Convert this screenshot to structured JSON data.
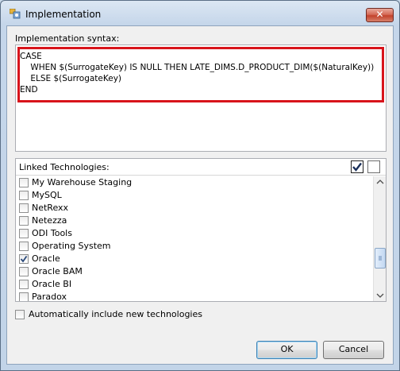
{
  "window": {
    "title": "Implementation",
    "close_label": "✕"
  },
  "syntax": {
    "label": "Implementation syntax:",
    "lines": [
      "CASE",
      "    WHEN $(SurrogateKey) IS NULL THEN LATE_DIMS.D_PRODUCT_DIM($(NaturalKey))",
      "    ELSE $(SurrogateKey)",
      "END"
    ],
    "highlight_color": "#d8141b"
  },
  "technologies": {
    "label": "Linked Technologies:",
    "items": [
      {
        "label": "My Warehouse Staging",
        "checked": false
      },
      {
        "label": "MySQL",
        "checked": false
      },
      {
        "label": "NetRexx",
        "checked": false
      },
      {
        "label": "Netezza",
        "checked": false
      },
      {
        "label": "ODI Tools",
        "checked": false
      },
      {
        "label": "Operating System",
        "checked": false
      },
      {
        "label": "Oracle",
        "checked": true
      },
      {
        "label": "Oracle BAM",
        "checked": false
      },
      {
        "label": "Oracle BI",
        "checked": false
      },
      {
        "label": "Paradox",
        "checked": false
      }
    ]
  },
  "auto_include": {
    "label": "Automatically include new technologies",
    "checked": false
  },
  "buttons": {
    "ok": "OK",
    "cancel": "Cancel"
  }
}
